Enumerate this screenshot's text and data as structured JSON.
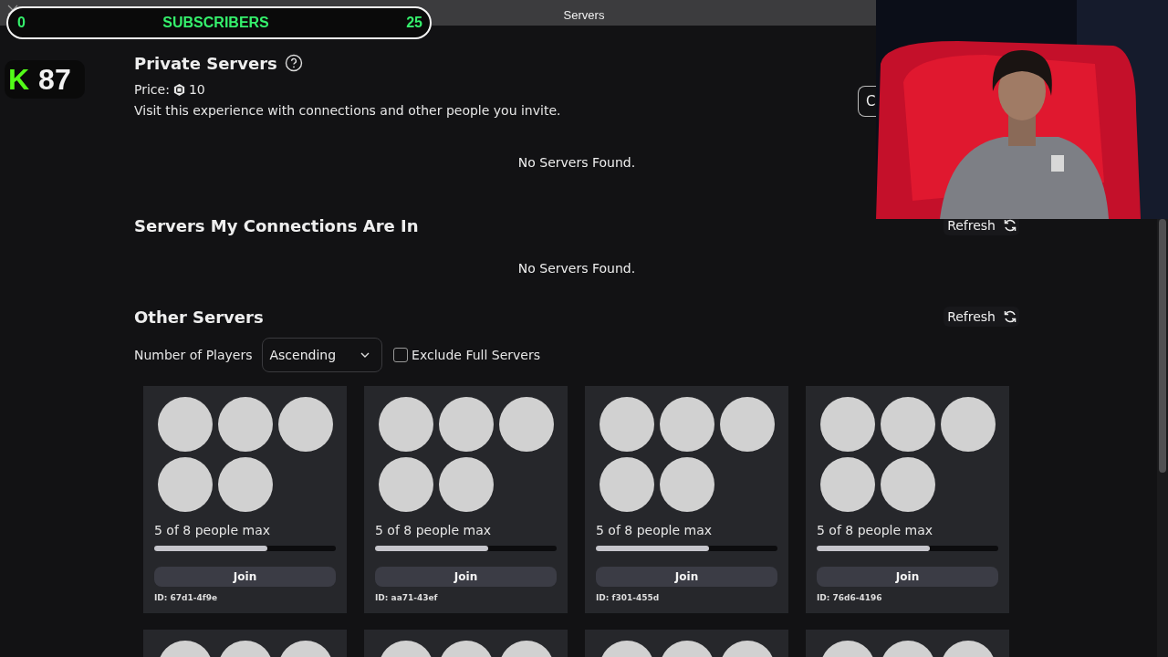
{
  "top_bar": {
    "title": "Servers"
  },
  "subscriber_bar": {
    "min": "0",
    "label": "SUBSCRIBERS",
    "max": "25"
  },
  "badge": {
    "logo": "K",
    "count": "87"
  },
  "private_servers": {
    "title": "Private Servers",
    "price_label": "Price:",
    "price": "10",
    "description": "Visit this experience with connections and other people you invite.",
    "create_button": "C",
    "empty": "No Servers Found."
  },
  "connections_servers": {
    "title": "Servers My Connections Are In",
    "refresh": "Refresh",
    "empty": "No Servers Found."
  },
  "other_servers": {
    "title": "Other Servers",
    "refresh": "Refresh",
    "sort_label": "Number of Players",
    "sort_value": "Ascending",
    "exclude_full": {
      "label": "Exclude Full Servers",
      "checked": false
    },
    "servers": [
      {
        "kind": "full",
        "players": "5 of 8 people max",
        "level": 0.625,
        "join": "Join",
        "id": "ID: 67d1-4f9e"
      },
      {
        "kind": "full",
        "players": "5 of 8 people max",
        "level": 0.625,
        "join": "Join",
        "id": "ID: aa71-43ef"
      },
      {
        "kind": "full",
        "players": "5 of 8 people max",
        "level": 0.625,
        "join": "Join",
        "id": "ID: f301-455d"
      },
      {
        "kind": "full",
        "players": "5 of 8 people max",
        "level": 0.625,
        "join": "Join",
        "id": "ID: 76d6-4196"
      },
      {
        "kind": "partial"
      },
      {
        "kind": "partial"
      },
      {
        "kind": "partial"
      },
      {
        "kind": "partial"
      }
    ]
  }
}
